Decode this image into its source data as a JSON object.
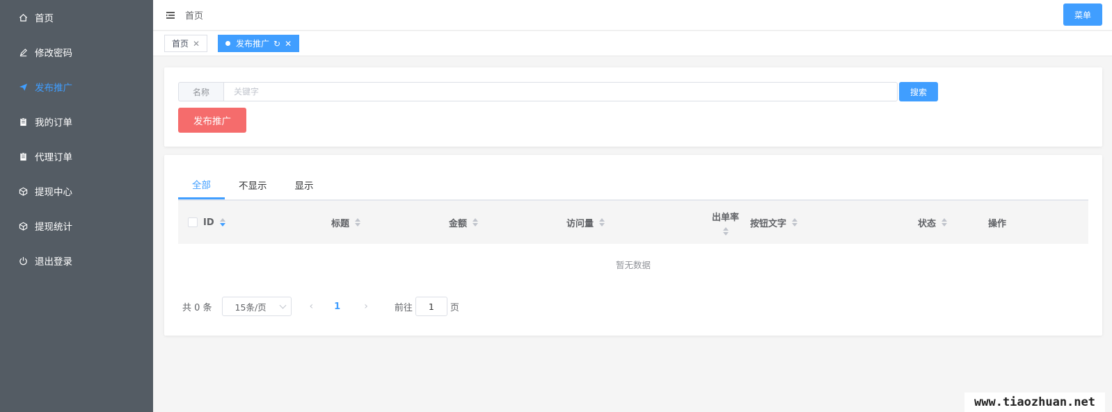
{
  "sidebar": {
    "items": [
      {
        "label": "首页",
        "icon": "home-icon"
      },
      {
        "label": "修改密码",
        "icon": "edit-icon"
      },
      {
        "label": "发布推广",
        "icon": "paper-plane-icon",
        "active": true
      },
      {
        "label": "我的订单",
        "icon": "clipboard-icon"
      },
      {
        "label": "代理订单",
        "icon": "clipboard-icon"
      },
      {
        "label": "提现中心",
        "icon": "box-icon"
      },
      {
        "label": "提现统计",
        "icon": "box-icon"
      },
      {
        "label": "退出登录",
        "icon": "power-icon"
      }
    ]
  },
  "header": {
    "breadcrumb": "首页",
    "menu_button": "菜单"
  },
  "page_tabs": [
    {
      "label": "首页",
      "close": "✕"
    },
    {
      "label": "发布推广",
      "refresh": "↻",
      "close": "✕",
      "active": true
    }
  ],
  "search": {
    "prepend_label": "名称",
    "placeholder": "关键字",
    "value": "",
    "button": "搜索"
  },
  "publish_button": "发布推广",
  "filter_tabs": [
    {
      "label": "全部",
      "active": true
    },
    {
      "label": "不显示"
    },
    {
      "label": "显示"
    }
  ],
  "table": {
    "columns": [
      "ID",
      "标题",
      "金额",
      "访问量",
      "出单率",
      "按钮文字",
      "状态",
      "操作"
    ],
    "empty_text": "暂无数据"
  },
  "pagination": {
    "total": "共 0 条",
    "page_size": "15条/页",
    "prev": "‹",
    "current": "1",
    "next": "›",
    "goto_label": "前往",
    "goto_value": "1",
    "page_suffix": "页"
  },
  "watermark": "www.tiaozhuan.net",
  "colors": {
    "sidebar_bg": "#545c64",
    "accent": "#409eff",
    "danger": "#f56c6c"
  }
}
